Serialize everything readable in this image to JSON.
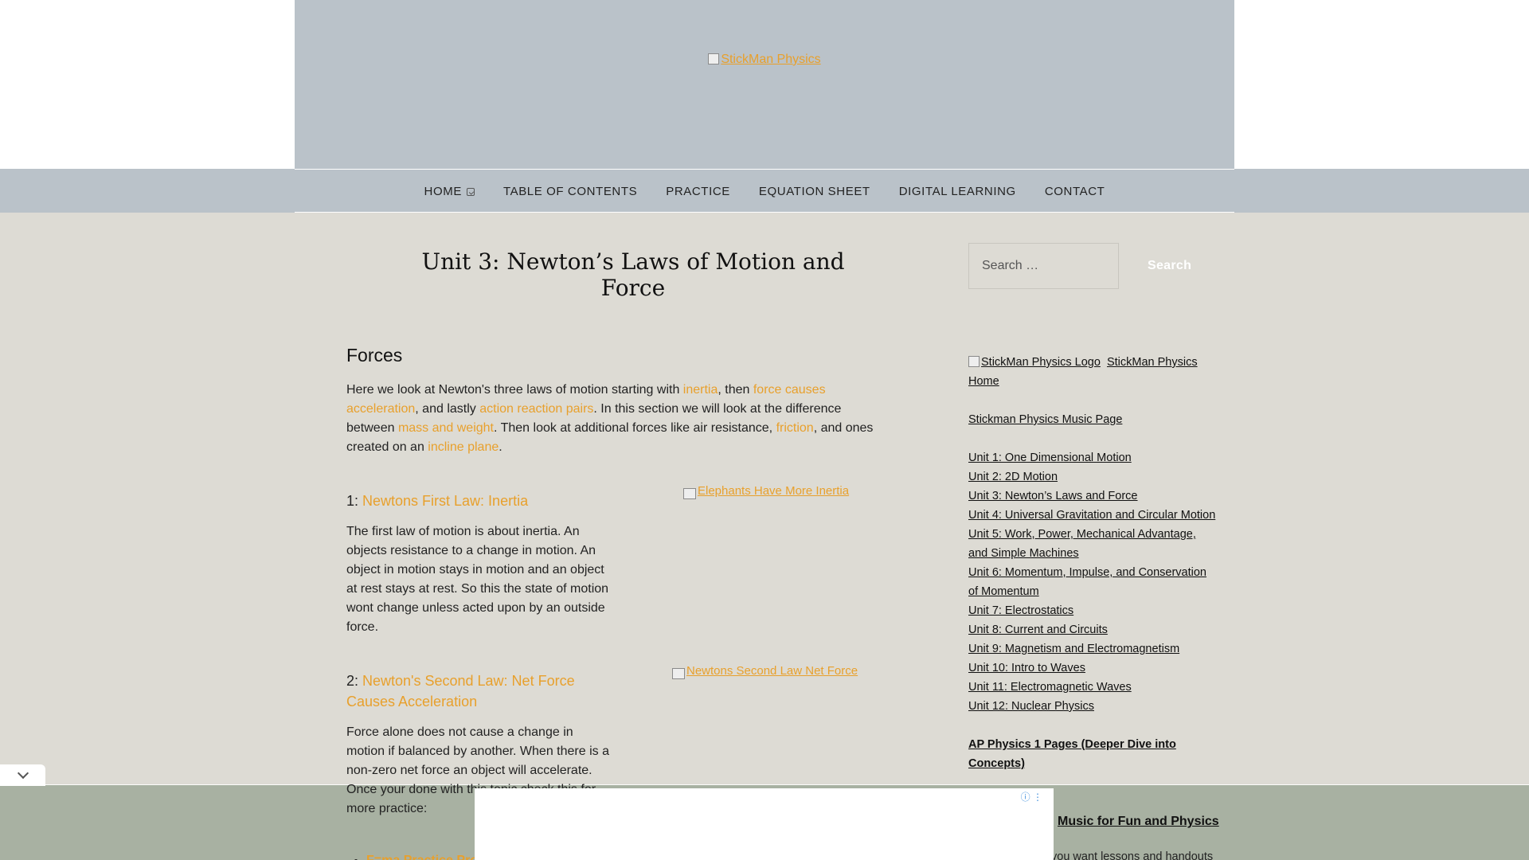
{
  "header": {
    "logo_alt": "StickMan Physics"
  },
  "nav": {
    "items": [
      "HOME",
      "TABLE OF CONTENTS",
      "PRACTICE",
      "EQUATION SHEET",
      "DIGITAL LEARNING",
      "CONTACT"
    ]
  },
  "main": {
    "title": "Unit 3: Newton’s Laws of Motion and Force",
    "section_title": "Forces",
    "intro": {
      "t1": "Here we look at Newton's three laws of motion starting with ",
      "l1": "inertia",
      "t2": ", then ",
      "l2": "force causes acceleration",
      "t3": ", and lastly ",
      "l3": "action reaction pairs",
      "t4": ".  In this section we will look at the difference between ",
      "l4": "mass and weight",
      "t5": ".  Then look at additional forces like air resistance, ",
      "l5": "friction",
      "t6": ", and ones created on an ",
      "l6": "incline plane",
      "t7": "."
    },
    "law1": {
      "number": "1: ",
      "link": "Newtons First Law: Inertia",
      "body": "The first law of motion is about inertia.  An objects resistance to a change in motion.  An object in motion stays in motion and an object at rest stays at rest.  So this the state of motion wont change unless acted upon by an outside force.",
      "image_alt": "Elephants Have More Inertia"
    },
    "law2": {
      "number": "2: ",
      "link": "Newton's Second Law: Net Force Causes Acceleration",
      "body": "Force alone does not cause a change in motion if balanced by another.  When there is a non-zero net force an object will accelerate.",
      "image_alt": "Newtons Second Law Net Force"
    },
    "after_text": "Once your done with this topic check this for more practice:",
    "practice_link": "F=ma Practice Problems"
  },
  "sidebar": {
    "search_placeholder": "Search …",
    "search_button": "Search",
    "logo_alt": "StickMan Physics Logo",
    "home_link": "StickMan Physics Home",
    "music_link": "Stickman Physics Music Page",
    "units": [
      "Unit 1: One Dimensional Motion",
      "Unit 2: 2D Motion",
      "Unit 3: Newton’s Laws and Force",
      "Unit 4: Universal Gravitation and Circular Motion",
      "Unit 5: Work, Power, Mechanical Advantage, and Simple Machines",
      "Unit 6: Momentum, Impulse, and Conservation of Momentum",
      "Unit 7: Electrostatics",
      "Unit 8: Current and Circuits",
      "Unit 9: Magnetism and Electromagnetism",
      "Unit 10: Intro to Waves",
      "Unit 11: Electromagnetic Waves",
      "Unit 12: Nuclear Physics"
    ],
    "ap_link": "AP Physics 1 Pages (Deeper Dive into Concepts)",
    "music_fun_link": "Music for Fun and Physics",
    "trailing_text": "you want lessons and handouts"
  },
  "ad": {
    "info_icon": "ⓘ"
  }
}
